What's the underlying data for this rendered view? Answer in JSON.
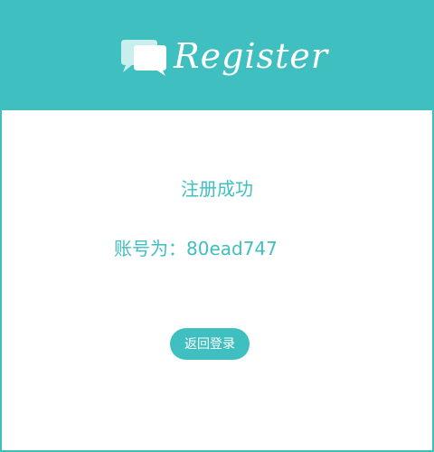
{
  "header": {
    "logo_icon": "chat-bubbles-icon",
    "title": "Register"
  },
  "main": {
    "success_message": "注册成功",
    "account_label": "账号为：",
    "account_value": "80ead747"
  },
  "actions": {
    "back_to_login_label": "返回登录"
  },
  "colors": {
    "accent": "#40bfc1",
    "text_on_accent": "#ffffff",
    "background": "#ffffff"
  }
}
